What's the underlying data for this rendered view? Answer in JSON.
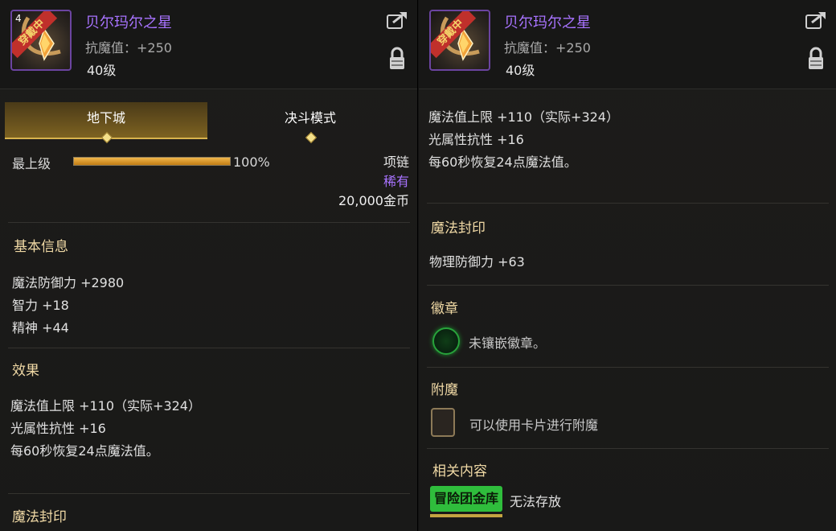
{
  "left": {
    "header": {
      "name": "贝尔玛尔之星",
      "resist": "抗魔值：+250",
      "level": "40级",
      "equipped_tag": "穿戴中",
      "badge": "4"
    },
    "tabs": [
      {
        "label": "地下城"
      },
      {
        "label": "决斗模式"
      }
    ],
    "summary": {
      "grade_label": "最上级",
      "percent": "100%",
      "percent_value": 100,
      "slot_type": "项链",
      "rarity": "稀有",
      "price": "20,000金币"
    },
    "basic_info": {
      "title": "基本信息",
      "lines": [
        "魔法防御力 +2980",
        "智力 +18",
        "精神 +44"
      ]
    },
    "effects": {
      "title": "效果",
      "lines": [
        "魔法值上限 +110（实际+324）",
        "光属性抗性 +16",
        "每60秒恢复24点魔法值。"
      ]
    },
    "magic_seal_title": "魔法封印"
  },
  "right": {
    "header": {
      "name": "贝尔玛尔之星",
      "resist": "抗魔值：+250",
      "level": "40级",
      "equipped_tag": "穿戴中"
    },
    "effects_lines": [
      "魔法值上限 +110（实际+324）",
      "光属性抗性 +16",
      "每60秒恢复24点魔法值。"
    ],
    "magic_seal": {
      "title": "魔法封印",
      "line": "物理防御力 +63"
    },
    "emblem": {
      "title": "徽章",
      "text": "未镶嵌徽章。"
    },
    "enchant": {
      "title": "附魔",
      "text": "可以使用卡片进行附魔"
    },
    "related": {
      "title": "相关内容",
      "tag": "冒险团金库",
      "text": "无法存放"
    }
  },
  "colors": {
    "name": "#a873ff",
    "section": "#f0d9a5",
    "accent_gold": "#d7b24d",
    "green_tag": "#2fbd3c"
  }
}
